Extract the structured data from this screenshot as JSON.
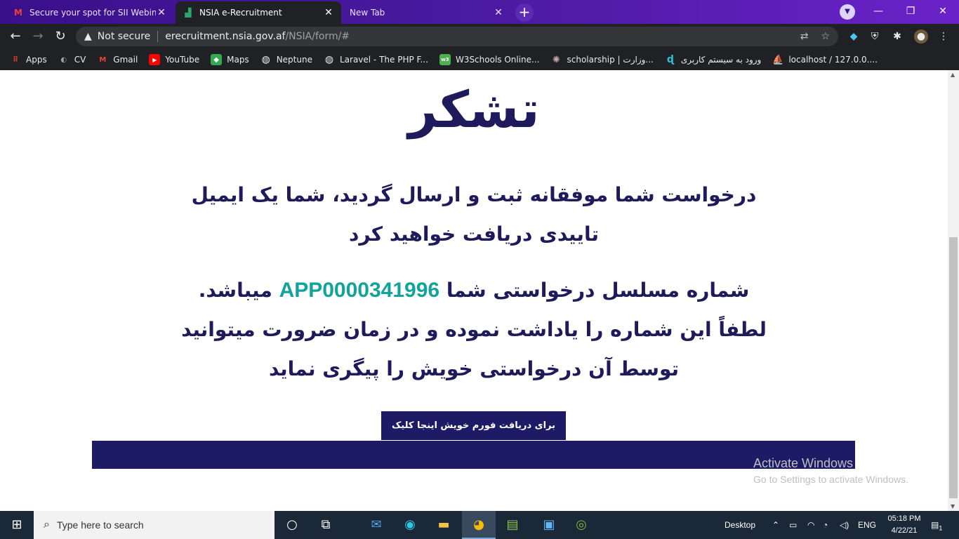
{
  "browser": {
    "tabs": [
      {
        "title": "Secure your spot for SII Webinar",
        "favicon": "M",
        "favicon_color": "#ea4335",
        "close": "✕"
      },
      {
        "title": "NSIA e-Recruitment",
        "favicon": "▟",
        "favicon_color": "#2ea36a",
        "close": "✕"
      },
      {
        "title": "New Tab",
        "favicon": "",
        "close": "✕"
      }
    ],
    "new_tab": "+",
    "window_controls": {
      "minimize": "—",
      "restore": "❐",
      "close": "✕"
    },
    "address": {
      "security_label": "Not secure",
      "host": "erecruitment.nsia.gov.af",
      "path": "/NSIA/form/#"
    },
    "bookmarks": [
      {
        "label": "Apps",
        "icon": "apps-grid-icon",
        "color": "#ea4335"
      },
      {
        "label": "CV",
        "icon": "cv-icon",
        "color": "#5f6368"
      },
      {
        "label": "Gmail",
        "icon": "gmail-icon",
        "color": "#ea4335"
      },
      {
        "label": "YouTube",
        "icon": "youtube-icon",
        "color": "#ff0000"
      },
      {
        "label": "Maps",
        "icon": "maps-icon",
        "color": "#34a853"
      },
      {
        "label": "Neptune",
        "icon": "globe-icon",
        "color": "#5f6368"
      },
      {
        "label": "Laravel - The PHP F...",
        "icon": "globe-icon",
        "color": "#5f6368"
      },
      {
        "label": "W3Schools Online...",
        "icon": "w3schools-icon",
        "color": "#4caf50"
      },
      {
        "label": "scholarship | وزارت...",
        "icon": "seal-icon",
        "color": "#8d6e63"
      },
      {
        "label": "ورود به سیستم کاربری",
        "icon": "login-icon",
        "color": "#26c6da"
      },
      {
        "label": "localhost / 127.0.0....",
        "icon": "phpmyadmin-icon",
        "color": "#f9a825"
      }
    ]
  },
  "page": {
    "heading": "تشکر",
    "message1": "درخواست شما موفقانه ثبت و ارسال گردید، شما یک ایمیل تاییدی دریافت خواهید کرد",
    "message2_before": "شماره مسلسل درخواستی شما",
    "application_number": "APP0000341996",
    "message2_after": "میباشد. لطفاً این شماره را یاداشت نموده و در زمان ضرورت میتوانید توسط آن درخواستی خویش را پیگری نماید",
    "download_button": "برای دریافت فورم خویش اینجا کلیک کنید",
    "colors": {
      "primary": "#1d1a66",
      "accent": "#12a39a"
    }
  },
  "watermark": {
    "line1": "Activate Windows",
    "line2": "Go to Settings to activate Windows."
  },
  "taskbar": {
    "search_placeholder": "Type here to search",
    "desktop_label": "Desktop",
    "language": "ENG",
    "time": "05:18 PM",
    "date": "4/22/21",
    "notification_count": "1"
  }
}
